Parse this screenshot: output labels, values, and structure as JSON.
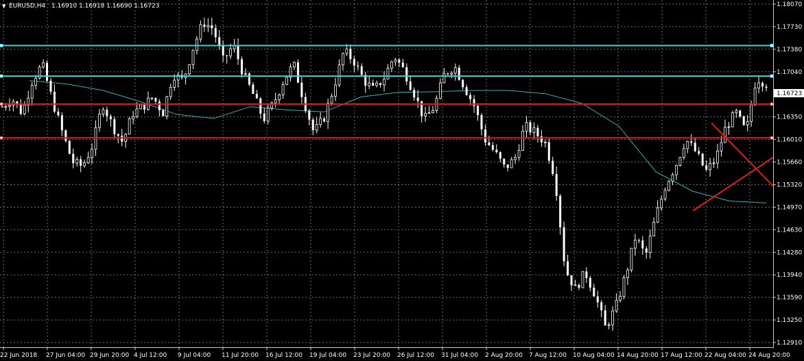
{
  "window": {
    "symbol_timeframe": "EURUSD,H4",
    "ohlc": "1.16910 1.16918 1.16690 1.16723",
    "menu_glyph": "▼"
  },
  "colors": {
    "background": "#000000",
    "grid": "#6f6f6f",
    "candle_bull_body": "#000000",
    "candle_bull_outline": "#ffffff",
    "candle_bear_body": "#ffffff",
    "wick": "#ffffff",
    "moving_average": "#2fb2b2",
    "horizontal_cyan": "#3fd3d9",
    "horizontal_red": "#e01b1b",
    "trendlines": "#e01b1b",
    "price_marker_bg": "#ffffff",
    "price_marker_text": "#000000"
  },
  "chart_data": {
    "type": "candlestick",
    "title": "EURUSD,H4  1.16910 1.16918 1.16690 1.16723",
    "xlabel": "",
    "ylabel": "",
    "grid": true,
    "ylim": [
      1.128,
      1.1814
    ],
    "y_ticks": [
      "1.18070",
      "1.17730",
      "1.17380",
      "1.17040",
      "1.16723",
      "1.16350",
      "1.16010",
      "1.15660",
      "1.15320",
      "1.14970",
      "1.14630",
      "1.14280",
      "1.13940",
      "1.13590",
      "1.13250",
      "1.12910"
    ],
    "current_price": "1.16723",
    "x_ticks": [
      "22 Jun 2018",
      "27 Jun 04:00",
      "29 Jun 20:00",
      "4 Jul 12:00",
      "9 Jul 04:00",
      "11 Jul 20:00",
      "16 Jul 12:00",
      "19 Jul 04:00",
      "23 Jul 20:00",
      "26 Jul 12:00",
      "31 Jul 04:00",
      "2 Aug 20:00",
      "7 Aug 12:00",
      "10 Aug 04:00",
      "14 Aug 20:00",
      "17 Aug 12:00",
      "22 Aug 04:00",
      "24 Aug 20:00"
    ],
    "horizontal_levels": [
      {
        "price": 1.1744,
        "color": "cyan"
      },
      {
        "price": 1.1697,
        "color": "cyan"
      },
      {
        "price": 1.1654,
        "color": "red"
      },
      {
        "price": 1.1602,
        "color": "red"
      }
    ],
    "trendlines": [
      {
        "from": {
          "x": "20 Aug 12:00",
          "y": 1.149
        },
        "to": {
          "x": "27 Aug 00:00",
          "y": 1.1572
        }
      },
      {
        "from": {
          "x": "21 Aug 20:00",
          "y": 1.1625
        },
        "to": {
          "x": "27 Aug 00:00",
          "y": 1.1528
        }
      }
    ],
    "price_path": [
      1.165,
      1.1662,
      1.164,
      1.169,
      1.1715,
      1.166,
      1.161,
      1.1565,
      1.1558,
      1.159,
      1.1655,
      1.162,
      1.1595,
      1.164,
      1.165,
      1.1665,
      1.164,
      1.17,
      1.169,
      1.174,
      1.178,
      1.177,
      1.172,
      1.1745,
      1.17,
      1.1668,
      1.163,
      1.1655,
      1.169,
      1.1715,
      1.166,
      1.161,
      1.1632,
      1.168,
      1.1736,
      1.172,
      1.169,
      1.1675,
      1.1695,
      1.1728,
      1.1705,
      1.167,
      1.163,
      1.165,
      1.17,
      1.1712,
      1.168,
      1.165,
      1.16,
      1.158,
      1.1555,
      1.157,
      1.162,
      1.161,
      1.1595,
      1.154,
      1.14,
      1.137,
      1.1395,
      1.136,
      1.131,
      1.134,
      1.139,
      1.145,
      1.142,
      1.148,
      1.153,
      1.156,
      1.16,
      1.158,
      1.155,
      1.157,
      1.162,
      1.164,
      1.161,
      1.1695,
      1.1685
    ],
    "ma_path": [
      1.169,
      1.1685,
      1.1675,
      1.1658,
      1.1638,
      1.1632,
      1.165,
      1.1645,
      1.1642,
      1.1665,
      1.1672,
      1.1673,
      1.1675,
      1.1675,
      1.167,
      1.1655,
      1.162,
      1.155,
      1.152,
      1.1505,
      1.1502
    ]
  }
}
